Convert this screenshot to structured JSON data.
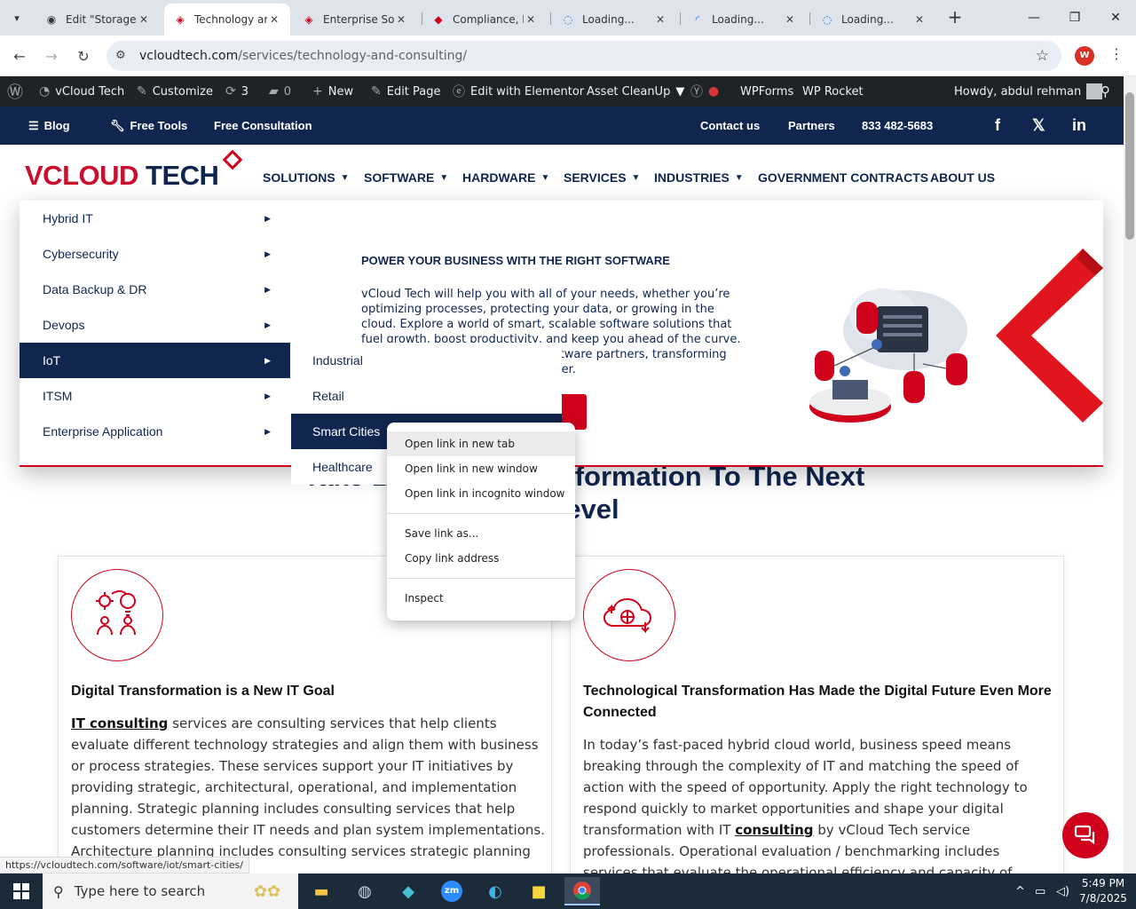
{
  "browser": {
    "tabs": [
      {
        "title": "Edit \"Storage",
        "active": false
      },
      {
        "title": "Technology ar",
        "active": true
      },
      {
        "title": "Enterprise Sof",
        "active": false
      },
      {
        "title": "Compliance, M",
        "active": false
      },
      {
        "title": "Loading...",
        "active": false
      },
      {
        "title": "Loading...",
        "active": false
      },
      {
        "title": "Loading...",
        "active": false
      }
    ],
    "url_host": "vcloudtech.com",
    "url_path": "/services/technology-and-consulting/",
    "profile_initial": "W"
  },
  "wp_admin": {
    "site_name": "vCloud Tech",
    "customize": "Customize",
    "updates": "3",
    "comments": "0",
    "new": "New",
    "edit_page": "Edit Page",
    "elementor": "Edit with Elementor",
    "asset_cleanup": "Asset CleanUp",
    "wpforms": "WPForms",
    "wp_rocket": "WP Rocket",
    "howdy": "Howdy, abdul rehman"
  },
  "topbar": {
    "blog": "Blog",
    "free_tools": "Free Tools",
    "free_consultation": "Free Consultation",
    "contact": "Contact us",
    "partners": "Partners",
    "phone": "833 482-5683"
  },
  "logo": {
    "v": "VCLOUD",
    "tech": " TECH"
  },
  "nav": [
    "SOLUTIONS",
    "SOFTWARE",
    "HARDWARE",
    "SERVICES",
    "INDUSTRIES",
    "GOVERNMENT CONTRACTS",
    "ABOUT US"
  ],
  "mega_menu": {
    "items": [
      "Hybrid IT",
      "Cybersecurity",
      "Data Backup & DR",
      "Devops",
      "IoT",
      "ITSM",
      "Enterprise Application"
    ],
    "active_item": "IoT",
    "submenu": [
      "Industrial",
      "Retail",
      "Smart Cities",
      "Healthcare"
    ],
    "active_sub": "Smart Cities",
    "title": "POWER YOUR BUSINESS WITH THE RIGHT SOFTWARE",
    "description": "vCloud Tech will help you with all of your needs, whether you’re optimizing processes, protecting your data, or growing in the cloud. Explore a world of smart, scalable software solutions that fuel growth, boost productivity, and keep you ahead of the curve. With our wide range of leading software partners, transforming your business has never been easier."
  },
  "page": {
    "headline_line1": "Take Business Transformation To The Next",
    "headline_line2": "Level",
    "card1": {
      "title": "Digital Transformation is a New IT Goal",
      "link": "IT consulting",
      "body": " services are consulting services that help clients evaluate different technology strategies and align them with business or process strategies. These services support your IT initiatives by providing strategic, architectural, operational, and implementation planning. Strategic planning includes consulting services that help customers determine their IT needs and plan system implementations. Architecture planning includes consulting services strategic planning with knowledge of new"
    },
    "card2": {
      "title": "Technological Transformation Has Made the Digital Future Even More Connected",
      "body_pre": "In today’s fast-paced hybrid cloud world, business speed means breaking through the complexity of IT and matching the speed of action with the speed of opportunity. Apply the right technology to respond quickly to market opportunities and shape your digital transformation with IT ",
      "link": "consulting",
      "body_post": " by vCloud Tech service professionals. Operational evaluation / benchmarking includes services that evaluate the operational efficiency and capacity of"
    }
  },
  "context_menu": {
    "items": [
      "Open link in new tab",
      "Open link in new window",
      "Open link in incognito window",
      "Save link as...",
      "Copy link address",
      "Inspect"
    ],
    "hovered": "Open link in new tab"
  },
  "status_url": "https://vcloudtech.com/software/iot/smart-cities/",
  "taskbar": {
    "search_placeholder": "Type here to search",
    "time": "5:49 PM",
    "date": "7/8/2025"
  },
  "colors": {
    "navy": "#11264f",
    "red": "#d0021b",
    "wp_bar": "#1d2327"
  }
}
